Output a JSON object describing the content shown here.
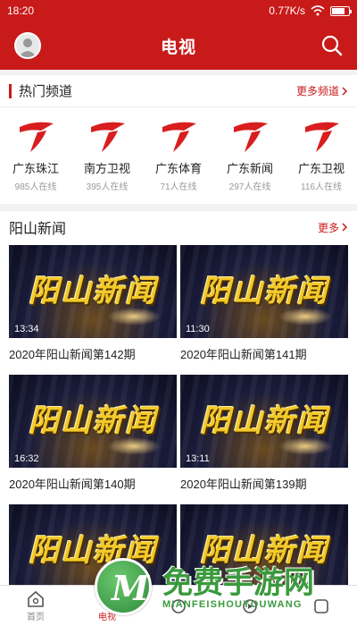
{
  "status_bar": {
    "time": "18:20",
    "speed": "0.77K/s"
  },
  "header": {
    "title": "电视"
  },
  "hot_channels": {
    "title": "热门频道",
    "more_label": "更多频道",
    "items": [
      {
        "name": "广东珠江",
        "viewers": "985人在线"
      },
      {
        "name": "南方卫视",
        "viewers": "395人在线"
      },
      {
        "name": "广东体育",
        "viewers": "71人在线"
      },
      {
        "name": "广东新闻",
        "viewers": "297人在线"
      },
      {
        "name": "广东卫视",
        "viewers": "116人在线"
      }
    ]
  },
  "news": {
    "title": "阳山新闻",
    "more_label": "更多",
    "thumb_text": "阳山新闻",
    "items": [
      {
        "duration": "13:34",
        "caption": "2020年阳山新闻第142期"
      },
      {
        "duration": "11:30",
        "caption": "2020年阳山新闻第141期"
      },
      {
        "duration": "16:32",
        "caption": "2020年阳山新闻第140期"
      },
      {
        "duration": "13:11",
        "caption": "2020年阳山新闻第139期"
      }
    ]
  },
  "bottom_nav": {
    "items": [
      {
        "label": "首页",
        "icon": "home-icon"
      },
      {
        "label": "电视",
        "icon": "tv-icon"
      },
      {
        "label": "",
        "icon": "radio-icon"
      },
      {
        "label": "",
        "icon": "live-icon"
      },
      {
        "label": "",
        "icon": "more-icon"
      }
    ]
  },
  "watermark": {
    "title": "免费手游网",
    "subtitle": "MIANFEISHOUYOUWANG",
    "logo_letter": "M"
  },
  "colors": {
    "brand_red": "#c91a1a",
    "watermark_green": "#3a9a3d"
  }
}
